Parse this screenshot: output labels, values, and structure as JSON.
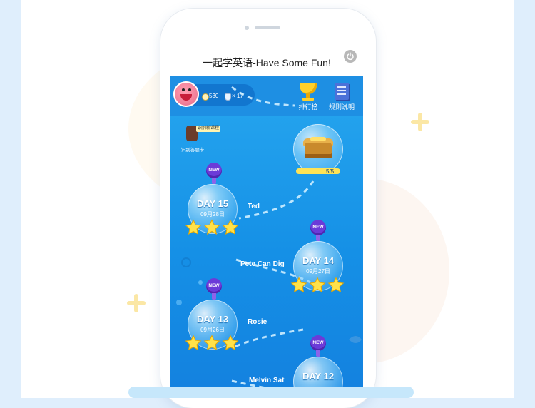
{
  "app": {
    "title": "一起学英语-Have Some Fun!"
  },
  "profile": {
    "coins": "530",
    "medals": "× 17"
  },
  "toolbar": {
    "rank_label": "排行榜",
    "rules_label": "规则说明"
  },
  "course_badge": {
    "tag": "识别新课程",
    "caption": "识别答题卡"
  },
  "chest": {
    "count": "5/5",
    "progress": 1.0
  },
  "levels": [
    {
      "day": "DAY 15",
      "date": "09月28日",
      "name": "Ted",
      "badge": "NEW",
      "stars": 3
    },
    {
      "day": "DAY 14",
      "date": "09月27日",
      "name": "Pete Can Dig",
      "badge": "NEW",
      "stars": 3
    },
    {
      "day": "DAY 13",
      "date": "09月26日",
      "name": "Rosie",
      "badge": "NEW",
      "stars": 3
    },
    {
      "day": "DAY 12",
      "date": "",
      "name": "Melvin Sat",
      "badge": "NEW",
      "stars": 0
    }
  ],
  "colors": {
    "star": "#ffe24a",
    "badge": "#6b3bd8",
    "sky": "#27a7ef"
  },
  "icons": [
    "power-icon",
    "trophy-icon",
    "book-icon",
    "coin-icon",
    "medal-icon",
    "star-icon",
    "treasure-chest-icon"
  ]
}
